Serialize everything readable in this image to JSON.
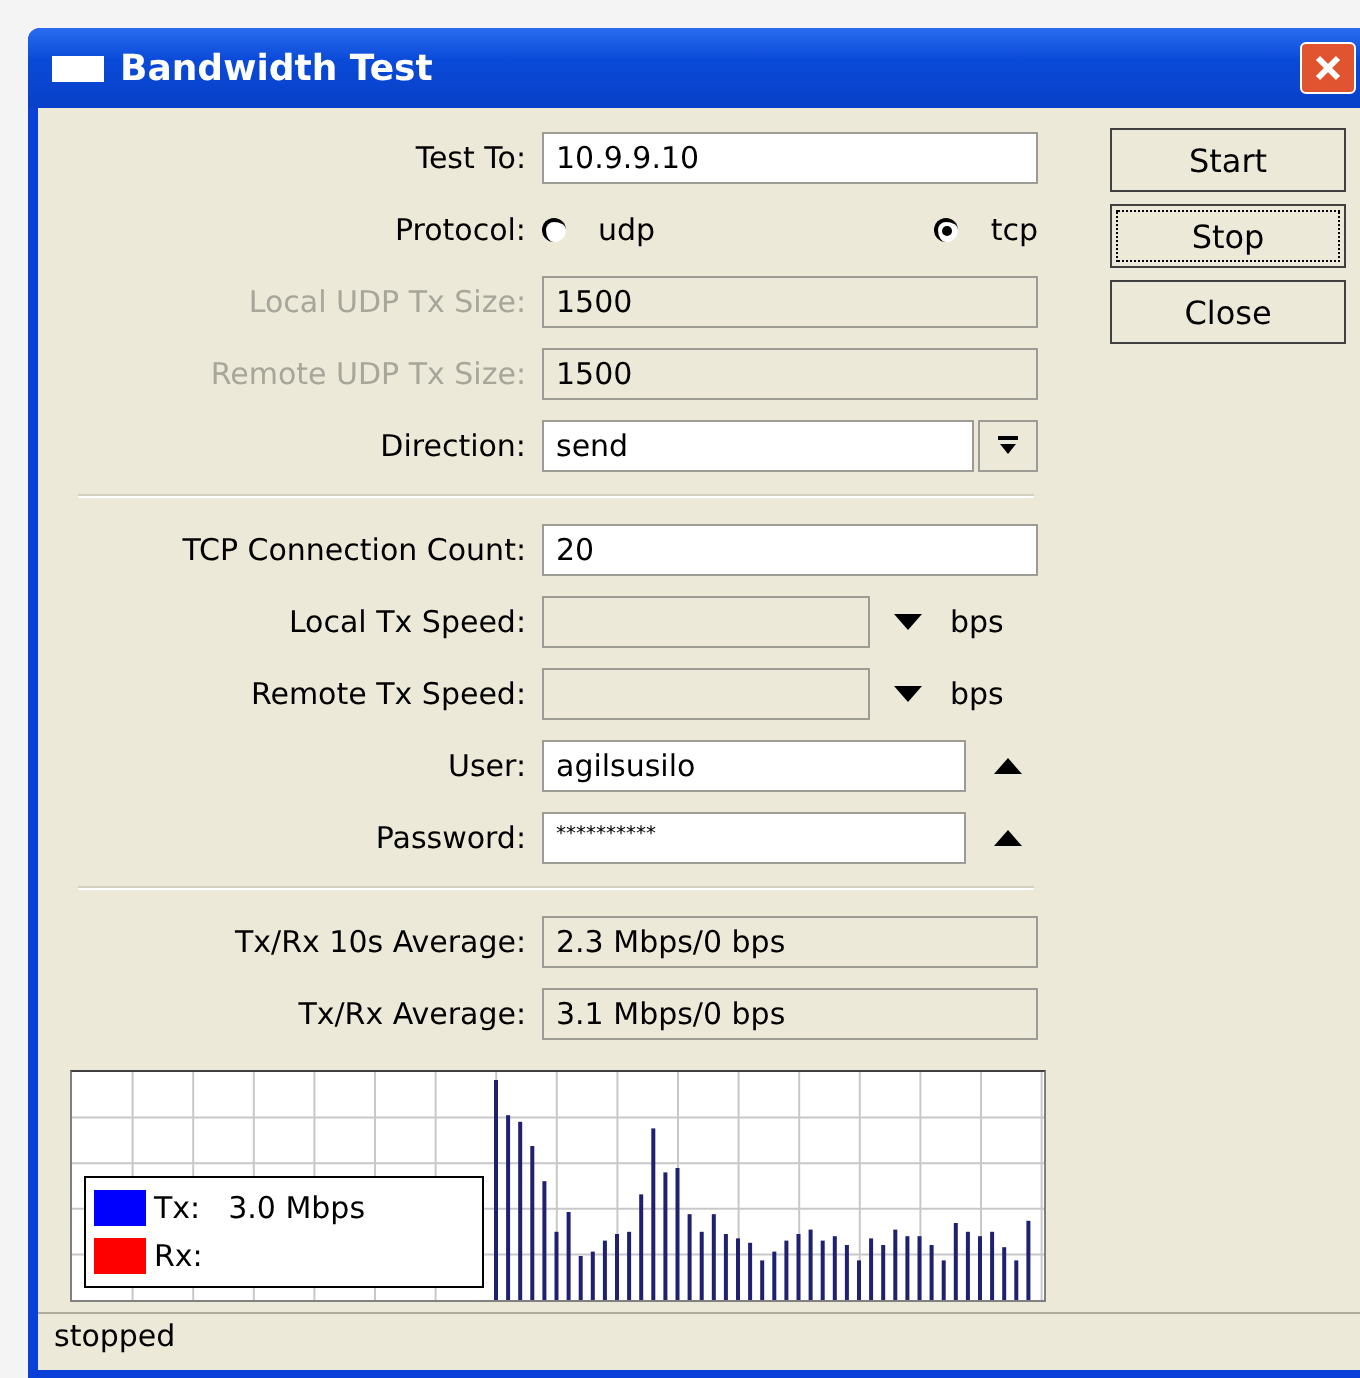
{
  "window": {
    "title": "Bandwidth Test"
  },
  "form_rows": [
    {
      "kind": "text",
      "label": "Test To:",
      "value": "10.9.9.10",
      "disabled": false
    },
    {
      "kind": "radio",
      "label": "Protocol:",
      "options": [
        {
          "label": "udp",
          "selected": false
        },
        {
          "label": "tcp",
          "selected": true
        }
      ],
      "disabled": false
    },
    {
      "kind": "text",
      "label": "Local UDP Tx Size:",
      "value": "1500",
      "disabled": true
    },
    {
      "kind": "text",
      "label": "Remote UDP Tx Size:",
      "value": "1500",
      "disabled": true
    },
    {
      "kind": "dropdown",
      "label": "Direction:",
      "value": "send",
      "disabled": false
    },
    {
      "kind": "divider"
    },
    {
      "kind": "text",
      "label": "TCP Connection Count:",
      "value": "20",
      "disabled": false
    },
    {
      "kind": "speed",
      "label": "Local Tx Speed:",
      "unit": "bps",
      "disabled": false
    },
    {
      "kind": "speed",
      "label": "Remote Tx Speed:",
      "unit": "bps",
      "disabled": false
    },
    {
      "kind": "collapsible",
      "label": "User:",
      "value": "agilsusilo",
      "disabled": false
    },
    {
      "kind": "collapsible",
      "label": "Password:",
      "value": "**********",
      "disabled": false
    },
    {
      "kind": "divider"
    },
    {
      "kind": "readonly",
      "label": "Tx/Rx 10s Average:",
      "value": "2.3 Mbps/0 bps",
      "disabled": false
    },
    {
      "kind": "readonly",
      "label": "Tx/Rx Average:",
      "value": "3.1 Mbps/0 bps",
      "disabled": false
    }
  ],
  "buttons": [
    {
      "label": "Start",
      "focused": false
    },
    {
      "label": "Stop",
      "focused": true
    },
    {
      "label": "Close",
      "focused": false
    }
  ],
  "legend": [
    {
      "label": "Tx:",
      "value": "3.0 Mbps",
      "color": "#0000ff"
    },
    {
      "label": "Rx:",
      "color": "#ff0000"
    }
  ],
  "status_bar": "stopped"
}
